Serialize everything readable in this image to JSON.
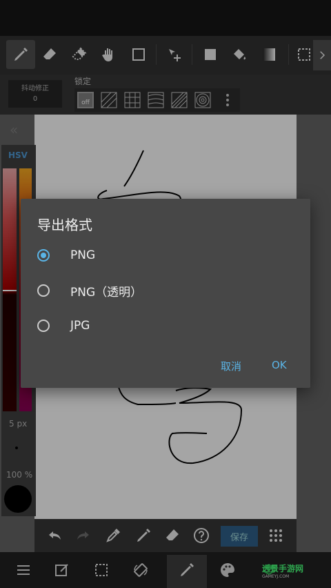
{
  "toolbar": {
    "tools": [
      "pen",
      "eraser",
      "eraser-soft",
      "hand",
      "rectangle",
      "move",
      "fill",
      "bucket",
      "gradient",
      "selection"
    ]
  },
  "subtoolbar": {
    "stabilizer_label": "抖动修正",
    "stabilizer_value": "0",
    "lock_label": "锁定",
    "lock_off": "off"
  },
  "color_panel": {
    "mode_label": "HSV",
    "brush_size": "5 px",
    "opacity": "100 %"
  },
  "bottom_tools": {
    "save_label": "保存"
  },
  "dialog": {
    "title": "导出格式",
    "options": [
      {
        "label": "PNG",
        "checked": true
      },
      {
        "label": "PNG（透明）",
        "checked": false
      },
      {
        "label": "JPG",
        "checked": false
      }
    ],
    "cancel_label": "取消",
    "ok_label": "OK"
  },
  "watermark": {
    "text": "远景手游网",
    "sub": "GAMEYJ.COM"
  },
  "colors": {
    "accent": "#5ab4e6",
    "dialog_bg": "#474747",
    "toolbar_bg": "#2e2e2e"
  }
}
